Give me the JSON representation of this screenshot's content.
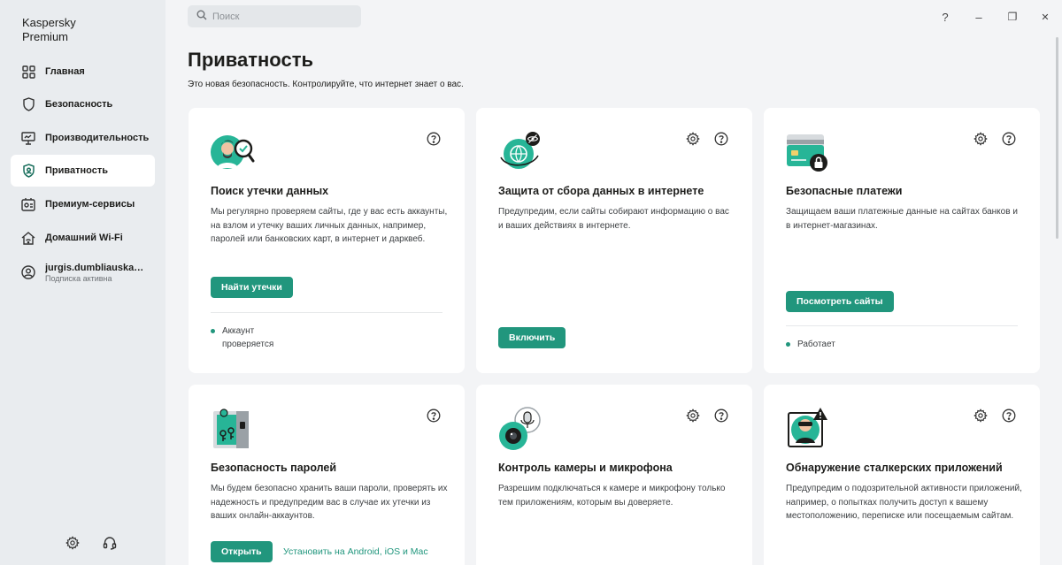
{
  "app": {
    "brand_line1": "Kaspersky",
    "brand_line2": "Premium"
  },
  "search": {
    "placeholder": "Поиск",
    "icon": "search-icon"
  },
  "window_controls": {
    "help": "?",
    "minimize": "–",
    "restore": "❐",
    "close": "✕"
  },
  "sidebar": {
    "items": [
      {
        "label": "Главная",
        "icon": "grid-icon"
      },
      {
        "label": "Безопасность",
        "icon": "shield-icon"
      },
      {
        "label": "Производительность",
        "icon": "monitor-icon"
      },
      {
        "label": "Приватность",
        "icon": "privacy-shield-icon",
        "active": true
      },
      {
        "label": "Премиум-сервисы",
        "icon": "premium-services-icon"
      },
      {
        "label": "Домашний Wi-Fi",
        "icon": "home-wifi-icon"
      }
    ],
    "account": {
      "name": "jurgis.dumbliauskas...",
      "status": "Подписка активна"
    },
    "bottom": [
      "gear-icon",
      "headset-icon"
    ]
  },
  "page": {
    "title": "Приватность",
    "subtitle": "Это новая безопасность. Контролируйте, что интернет знает о вас."
  },
  "cards": [
    {
      "title": "Поиск утечки данных",
      "desc": "Мы регулярно проверяем сайты, где у вас есть аккаунты, на взлом и утечку ваших личных данных, например, паролей или банковских карт, в интернет и дарквеб.",
      "button": "Найти утечки",
      "status": "Аккаунт проверяется"
    },
    {
      "title": "Защита от сбора данных в интернете",
      "desc": "Предупредим, если сайты собирают информацию о вас и ваших действиях в интернете.",
      "button": "Включить"
    },
    {
      "title": "Безопасные платежи",
      "desc": "Защищаем ваши платежные данные на сайтах банков и в интернет-магазинах.",
      "button": "Посмотреть сайты",
      "status": "Работает"
    },
    {
      "title": "Безопасность паролей",
      "desc": "Мы будем безопасно хранить ваши пароли, проверять их надежность и предупредим вас в случае их утечки из ваших онлайн-аккаунтов.",
      "button": "Открыть",
      "link": "Установить на Android, iOS и Mac"
    },
    {
      "title": "Контроль камеры и микрофона",
      "desc": "Разрешим подключаться к камере и микрофону только тем приложениям, которым вы доверяете."
    },
    {
      "title": "Обнаружение сталкерских приложений",
      "desc": "Предупредим о подозрительной активности приложений, например, о попытках получить доступ к вашему местоположению, переписке или посещаемым сайтам."
    }
  ],
  "colors": {
    "accent": "#21967d",
    "sidebar": "#e9ecef",
    "background": "#f3f4f6"
  }
}
